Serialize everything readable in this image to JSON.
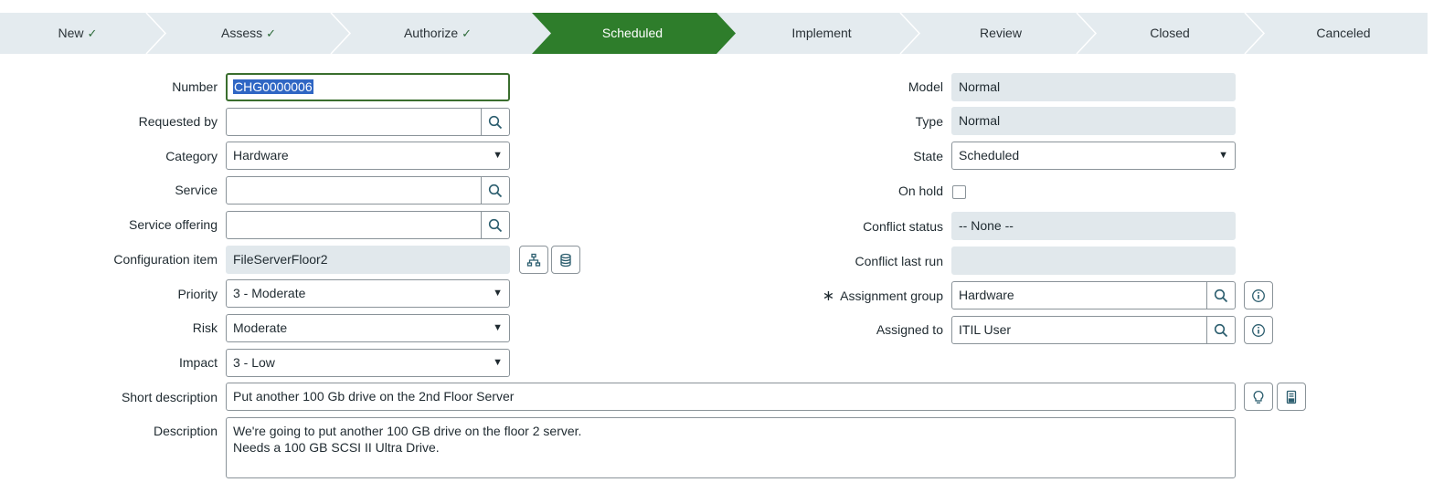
{
  "flow": {
    "stages": [
      {
        "label": "New",
        "done": true
      },
      {
        "label": "Assess",
        "done": true
      },
      {
        "label": "Authorize",
        "done": true
      },
      {
        "label": "Scheduled",
        "active": true
      },
      {
        "label": "Implement"
      },
      {
        "label": "Review"
      },
      {
        "label": "Closed"
      },
      {
        "label": "Canceled"
      }
    ],
    "check": "✓",
    "active_color": "#2e7d2b"
  },
  "form": {
    "number": {
      "label": "Number",
      "value": "CHG0000006"
    },
    "requested_by": {
      "label": "Requested by",
      "value": ""
    },
    "category": {
      "label": "Category",
      "value": "Hardware"
    },
    "service": {
      "label": "Service",
      "value": ""
    },
    "service_offering": {
      "label": "Service offering",
      "value": ""
    },
    "configuration_item": {
      "label": "Configuration item",
      "value": "FileServerFloor2"
    },
    "priority": {
      "label": "Priority",
      "value": "3 - Moderate"
    },
    "risk": {
      "label": "Risk",
      "value": "Moderate"
    },
    "impact": {
      "label": "Impact",
      "value": "3 - Low"
    },
    "short_description": {
      "label": "Short description",
      "value": "Put another 100 Gb drive on the 2nd Floor Server"
    },
    "description": {
      "label": "Description",
      "value": "We're going to put another 100 GB drive on the floor 2 server.\nNeeds a 100 GB SCSI II Ultra Drive."
    },
    "model": {
      "label": "Model",
      "value": "Normal"
    },
    "type": {
      "label": "Type",
      "value": "Normal"
    },
    "state": {
      "label": "State",
      "value": "Scheduled"
    },
    "on_hold": {
      "label": "On hold",
      "checked": false
    },
    "conflict_status": {
      "label": "Conflict status",
      "value": "-- None --"
    },
    "conflict_last_run": {
      "label": "Conflict last run",
      "value": ""
    },
    "assignment_group": {
      "label": "Assignment group",
      "value": "Hardware",
      "required_mark": "∗"
    },
    "assigned_to": {
      "label": "Assigned to",
      "value": "ITIL User"
    }
  },
  "icons": {
    "lookup": "search-icon",
    "dependency": "dependency-map-icon",
    "ci_details": "database-icon",
    "info": "info-icon",
    "suggest": "lightbulb-icon",
    "template": "template-book-icon"
  }
}
